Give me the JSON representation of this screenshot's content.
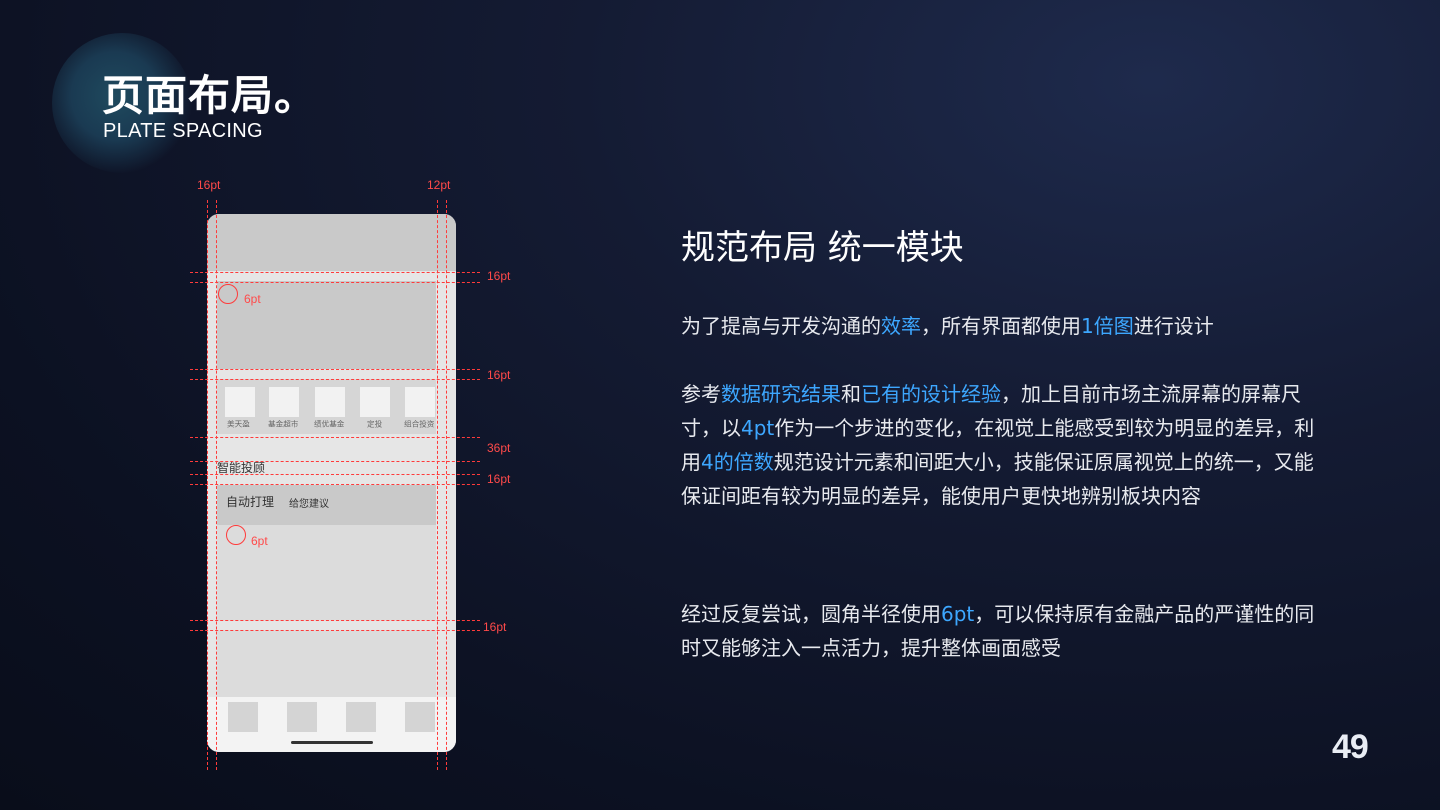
{
  "header": {
    "title_cn": "页面布局。",
    "title_en": "PLATE SPACING"
  },
  "page_number": "49",
  "phone": {
    "icons": [
      "美天盈",
      "基金超市",
      "绩优基金",
      "定投",
      "组合投资"
    ],
    "section_title": "智能投顾",
    "tab_primary": "自动打理",
    "tab_secondary": "给您建议"
  },
  "annotations": {
    "left_margin": "16pt",
    "right_margin": "12pt",
    "gap_1": "16pt",
    "gap_2": "16pt",
    "gap_3": "36pt",
    "gap_4": "16pt",
    "gap_5": "16pt",
    "radius_1": "6pt",
    "radius_2": "6pt"
  },
  "content": {
    "heading": "规范布局 统一模块",
    "p1": [
      {
        "t": "为了提高与开发沟通的",
        "hl": false
      },
      {
        "t": "效率",
        "hl": true
      },
      {
        "t": "，所有界面都使用",
        "hl": false
      },
      {
        "t": "1倍图",
        "hl": true
      },
      {
        "t": "进行设计",
        "hl": false
      }
    ],
    "p2": [
      {
        "t": "参考",
        "hl": false
      },
      {
        "t": "数据研究结果",
        "hl": true
      },
      {
        "t": "和",
        "hl": false
      },
      {
        "t": "已有的设计经验",
        "hl": true
      },
      {
        "t": "，加上目前市场主流屏幕的屏幕尺寸，以",
        "hl": false
      },
      {
        "t": "4pt",
        "hl": true
      },
      {
        "t": "作为一个步进的变化，在视觉上能感受到较为明显的差异，利用",
        "hl": false
      },
      {
        "t": "4的倍数",
        "hl": true
      },
      {
        "t": "规范设计元素和间距大小，技能保证原属视觉上的统一，又能保证间距有较为明显的差异，能使用户更快地辨别板块内容",
        "hl": false
      }
    ],
    "p3": [
      {
        "t": "经过反复尝试，圆角半径使用",
        "hl": false
      },
      {
        "t": "6pt",
        "hl": true
      },
      {
        "t": "，可以保持原有金融产品的严谨性的同时又能够注入一点活力，提升整体画面感受",
        "hl": false
      }
    ]
  },
  "colors": {
    "accent": "#3da7ff",
    "guide": "#ff3b3b",
    "background": "#0c1122"
  }
}
